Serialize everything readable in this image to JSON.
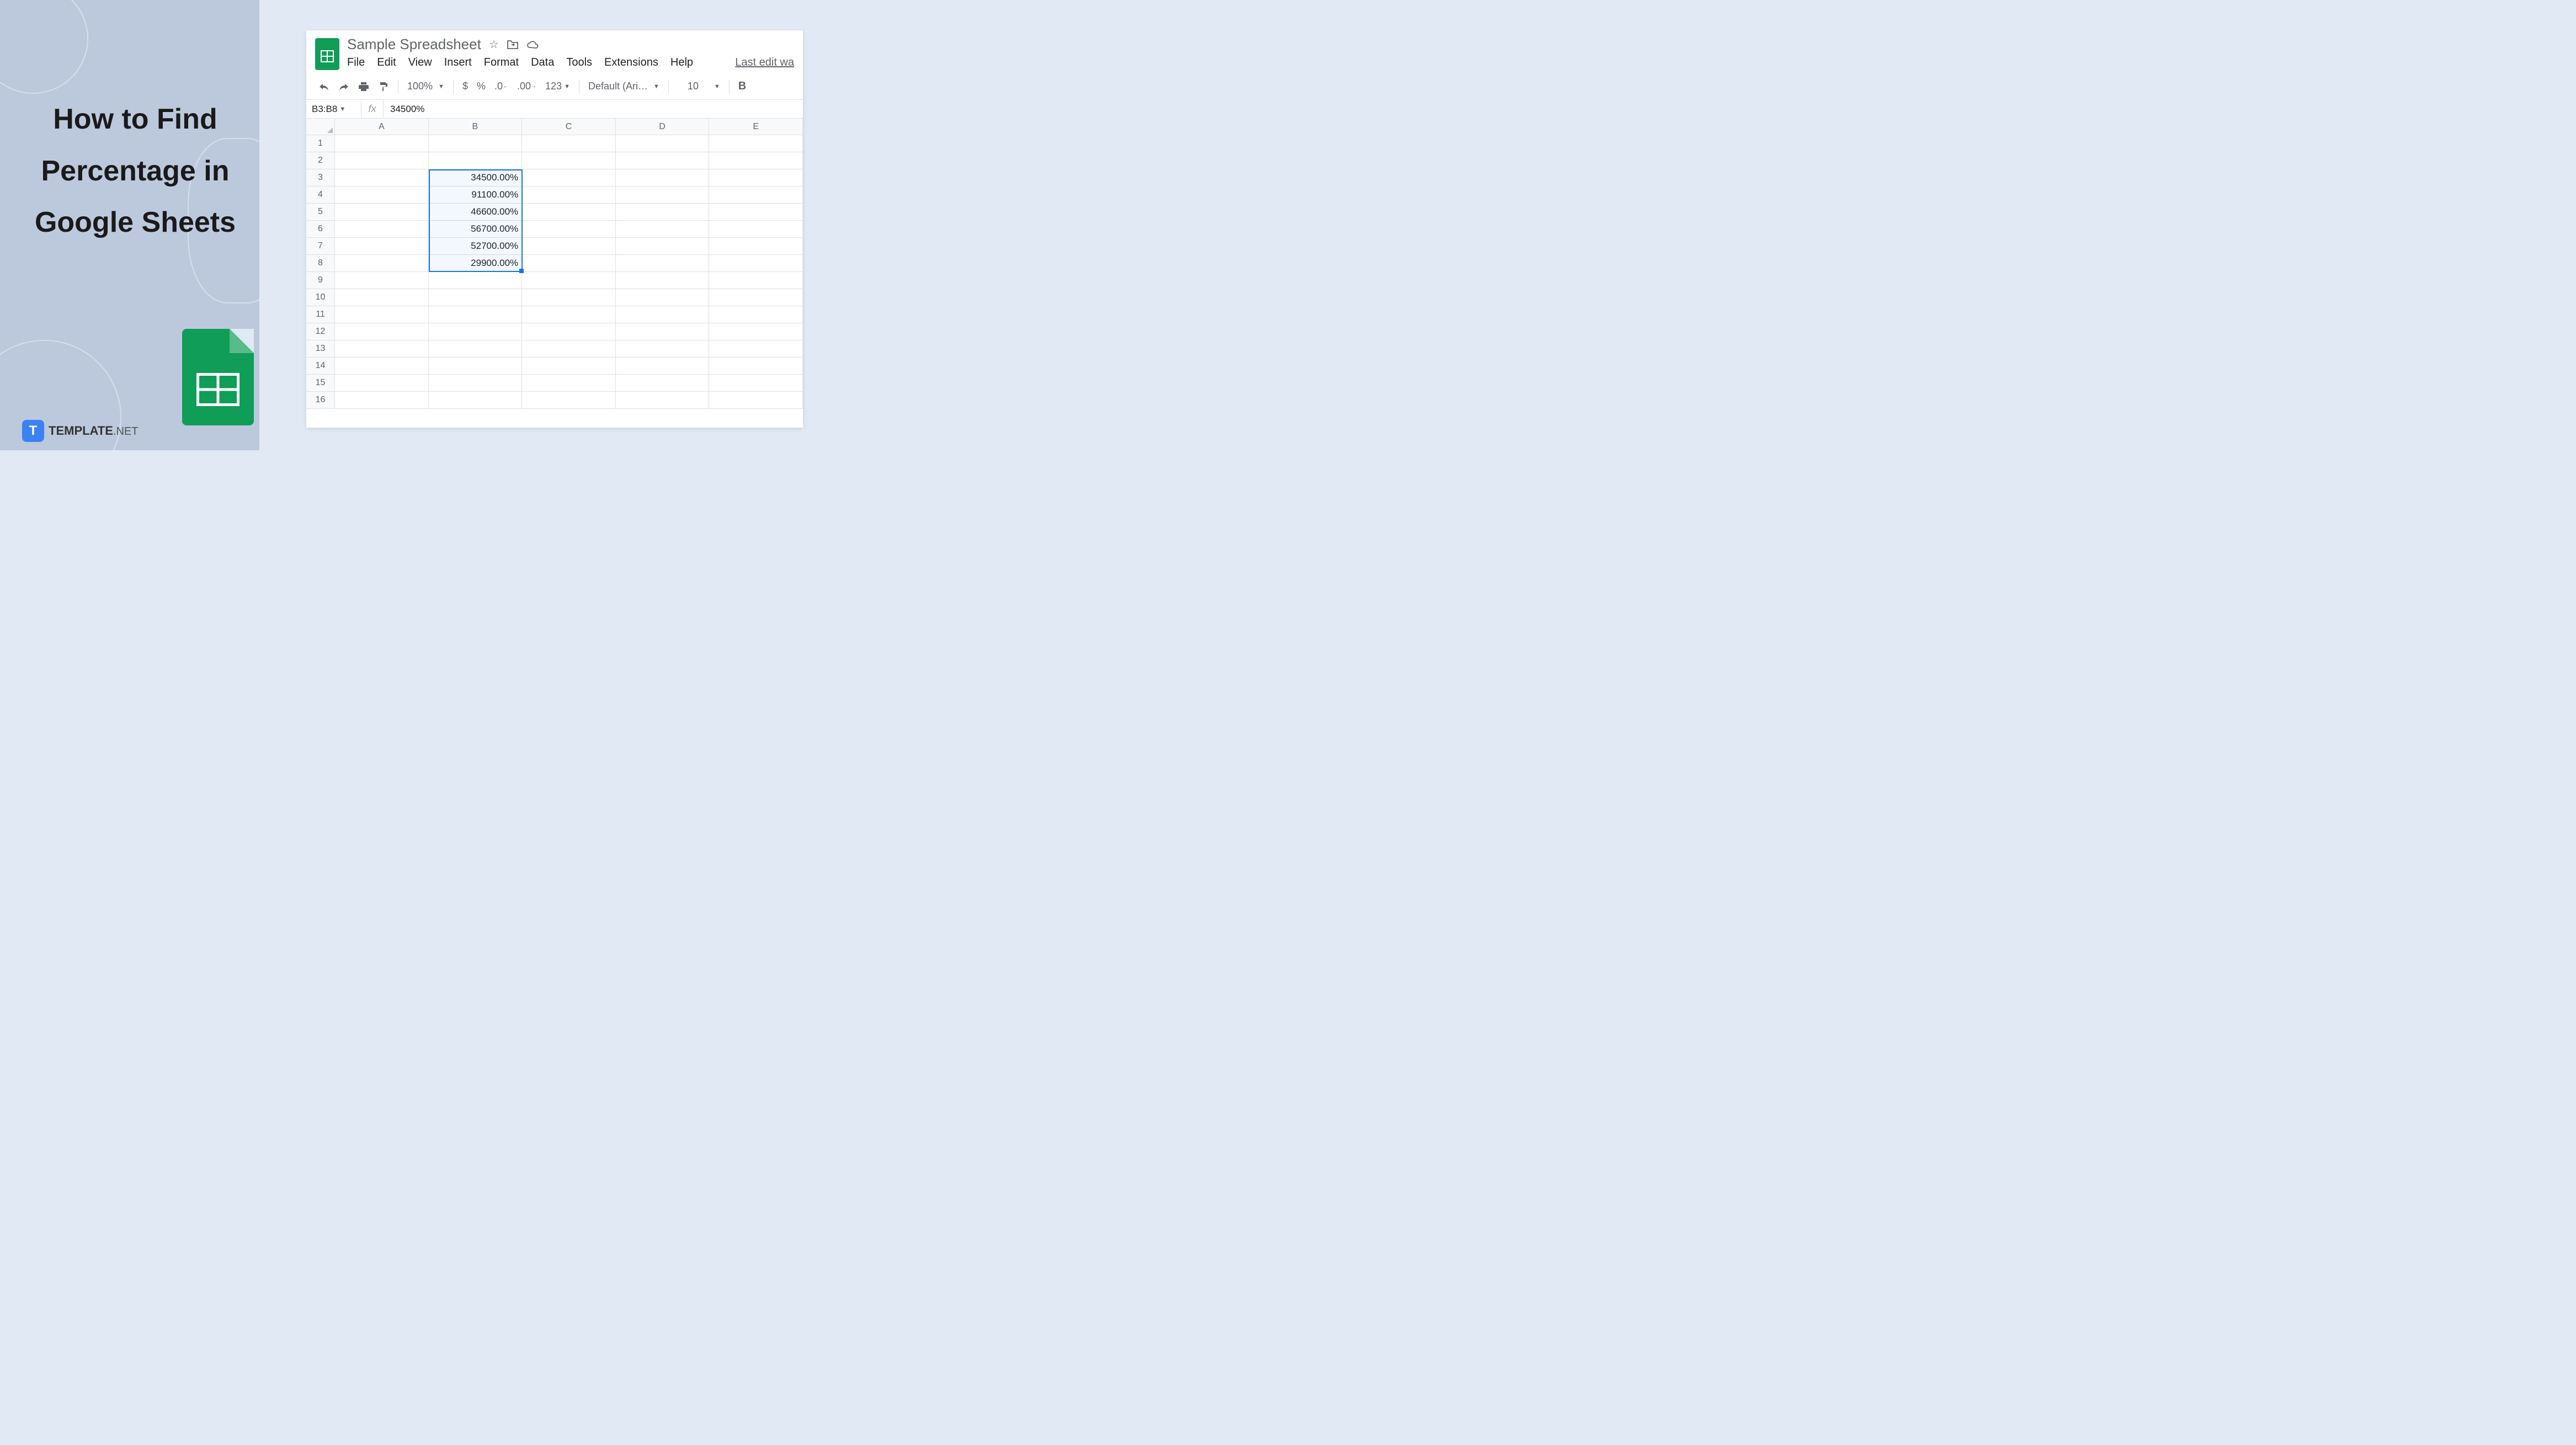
{
  "leftPanel": {
    "titleLine1": "How to Find",
    "titleLine2": "Percentage in",
    "titleLine3": "Google Sheets",
    "brandName": "TEMPLATE",
    "brandSuffix": ".NET",
    "brandIcon": "T"
  },
  "spreadsheet": {
    "title": "Sample Spreadsheet",
    "menus": [
      "File",
      "Edit",
      "View",
      "Insert",
      "Format",
      "Data",
      "Tools",
      "Extensions",
      "Help"
    ],
    "lastEdit": "Last edit wa",
    "toolbar": {
      "zoom": "100%",
      "font": "Default (Ari…",
      "fontSize": "10",
      "currency": "$",
      "percent": "%",
      "decDecrease": ".0",
      "decIncrease": ".00",
      "numFormat": "123"
    },
    "formulaBar": {
      "cellRef": "B3:B8",
      "value": "34500%"
    },
    "columns": [
      "A",
      "B",
      "C",
      "D",
      "E"
    ],
    "rowCount": 16,
    "selection": {
      "col": "B",
      "startRow": 3,
      "endRow": 8
    },
    "cells": {
      "B3": "34500.00%",
      "B4": "91100.00%",
      "B5": "46600.00%",
      "B6": "56700.00%",
      "B7": "52700.00%",
      "B8": "29900.00%"
    }
  }
}
